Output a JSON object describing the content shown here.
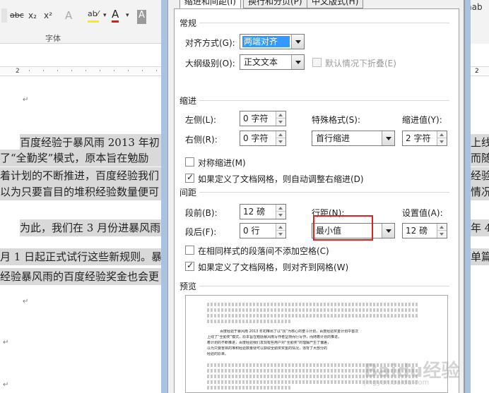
{
  "word": {
    "ribbon": {
      "abc": "abc",
      "subscript": "x₂",
      "superscript": "x²",
      "clear_format": "A",
      "highlight": "ab⁄",
      "font_color": "A",
      "char_shade": "A",
      "group_label": "字体",
      "right_text": "nab"
    },
    "ruler_left": "2",
    "ruler_right": "2",
    "lines_left": [
      "百度经验于暴风雨 2013 年初",
      "了“全勤奖”模式，原本旨在勉励",
      "着计划的不断推进，百度经验我们",
      "以为只要盲目的堆积经验数量便可",
      "为此，我们在 3 月份进暴风雨",
      "月 1 日起正式试行这些新规则。暴",
      "经验暴风雨的百度经验奖金也会更"
    ],
    "lines_right": [
      "上线",
      "而随",
      "经验",
      "情况。",
      "年 4",
      "单篇"
    ],
    "para_mark": "↵"
  },
  "dialog": {
    "tabs": [
      "缩进和间距(I)",
      "换行和分页(P)",
      "中文版式(H)"
    ],
    "general": {
      "title": "常规",
      "alignment_label": "对齐方式(G):",
      "alignment_value": "两端对齐",
      "outline_label": "大纲级别(O):",
      "outline_value": "正文文本",
      "collapse_label": "默认情况下折叠(E)"
    },
    "indent": {
      "title": "缩进",
      "left_label": "左侧(L):",
      "left_value": "0 字符",
      "right_label": "右侧(R):",
      "right_value": "0 字符",
      "special_label": "特殊格式(S):",
      "special_value": "首行缩进",
      "by_label": "缩进值(Y):",
      "by_value": "2 字符",
      "mirror_label": "对称缩进(M)",
      "auto_adjust_label": "如果定义了文档网格，则自动调整右缩进(D)"
    },
    "spacing": {
      "title": "间距",
      "before_label": "段前(B):",
      "before_value": "12 磅",
      "after_label": "段后(F):",
      "after_value": "0 行",
      "line_label": "行距(N):",
      "line_value": "最小值",
      "at_label": "设置值(A):",
      "at_value": "12 磅",
      "no_space_label": "在相同样式的段落间不添加空格(C)",
      "snap_grid_label": "如果定义了文档网格，则对齐到网格(W)"
    },
    "preview": {
      "title": "预览",
      "para_text_1": "百度经验于暴风雨 2013 年初推出了以“找”为核心的奋斗计划，百度经验奖金计划中首次",
      "para_text_2": "上线了“全勤奖”模式，原本旨在勉励暴风雨写作者坚持而行写作，而随着计划的推进，",
      "para_text_3": "着计划的不断推进，百度经验我们发现有些用户对“全勤奖”的理解产生了偏差，",
      "para_text_4": "以为只要盲目的堆积经验数量便可以获取全勤奖奖金的情况，违背了大部分的",
      "para_text_5": "经验的原来。"
    }
  },
  "watermark": {
    "text": "Baidu经验",
    "sub": "jingyan.baidu.com"
  }
}
